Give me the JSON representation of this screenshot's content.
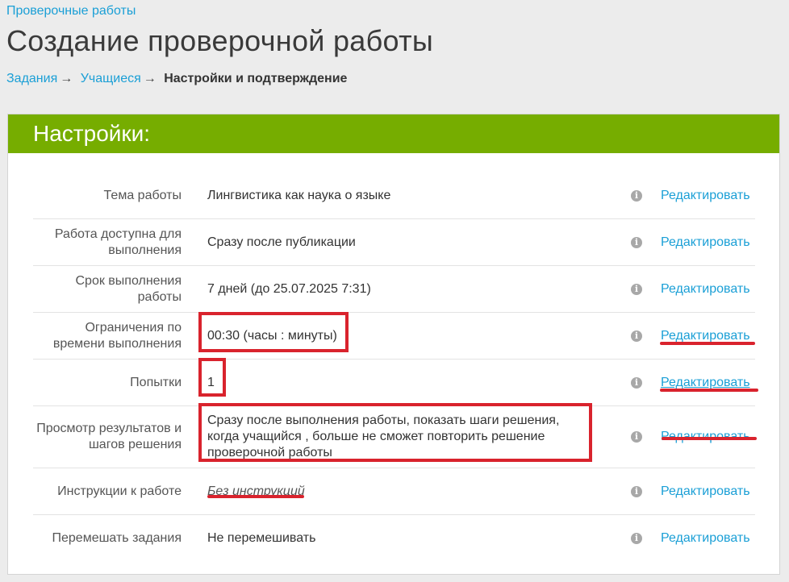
{
  "nav": {
    "top_link": "Проверочные работы"
  },
  "page": {
    "title": "Создание проверочной работы"
  },
  "breadcrumb": {
    "steps": [
      "Задания",
      "Учащиеся",
      "Настройки и подтверждение"
    ],
    "separator": "→"
  },
  "settings": {
    "header": "Настройки:",
    "info_icon": "i",
    "edit_label": "Редактировать",
    "rows": [
      {
        "label": "Тема работы",
        "value": "Лингвистика как наука о языке"
      },
      {
        "label": "Работа доступна для выполнения",
        "value": "Сразу после публикации"
      },
      {
        "label": "Срок выполнения работы",
        "value": "7 дней (до 25.07.2025 7:31)"
      },
      {
        "label": "Ограничения по времени выполнения",
        "value": "00:30 (часы : минуты)"
      },
      {
        "label": "Попытки",
        "value": "1"
      },
      {
        "label": "Просмотр результатов и шагов решения",
        "value": "Сразу после выполнения работы, показать шаги решения, когда учащийся , больше не сможет повторить решение проверочной работы"
      },
      {
        "label": "Инструкции к работе",
        "value": "Без инструкций"
      },
      {
        "label": "Перемешать задания",
        "value": "Не перемешивать"
      }
    ]
  },
  "colors": {
    "accent_green": "#76ad00",
    "link_blue": "#1a9fd6",
    "annotation_red": "#d9232d"
  }
}
